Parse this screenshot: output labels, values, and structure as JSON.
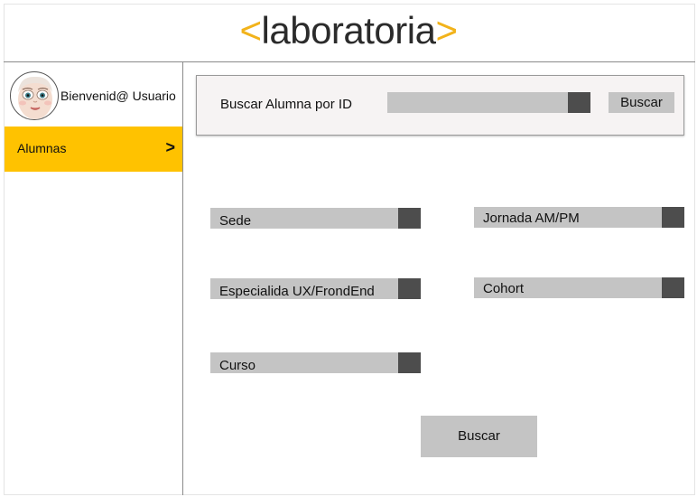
{
  "header": {
    "logo_open": "<",
    "logo_word": "laboratoria",
    "logo_close": ">",
    "accent_color": "#f2b31b"
  },
  "sidebar": {
    "avatar_icon": "doll-face-avatar",
    "welcome": "Bienvenid@ Usuario",
    "items": [
      {
        "label": "Alumnas",
        "arrow": ">",
        "active": true,
        "color": "#ffc200"
      }
    ]
  },
  "search": {
    "label": "Buscar Alumna por ID",
    "input_value": "",
    "button": "Buscar"
  },
  "filters": {
    "sede": "Sede",
    "jornada": "Jornada AM/PM",
    "especialidad": "Especialida UX/FrondEnd",
    "cohort": "Cohort",
    "curso": "Curso"
  },
  "actions": {
    "submit": "Buscar"
  }
}
